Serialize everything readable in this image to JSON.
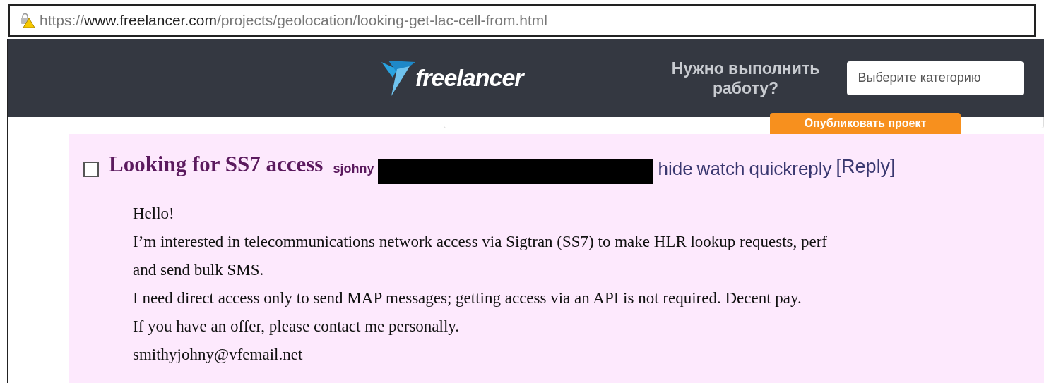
{
  "address_bar": {
    "scheme": "https://",
    "domain": "www.freelancer.com",
    "path": "/projects/geolocation/looking-get-lac-cell-from.html"
  },
  "header": {
    "logo": "freelancer",
    "prompt": "Нужно выполнить работу?",
    "category_field": {
      "placeholder": "Выберите категорию"
    },
    "post_button": "Опубликовать проект"
  },
  "post": {
    "checked": false,
    "title": "Looking for SS7 access",
    "author": "sjohny",
    "actions": [
      "hide",
      "watch",
      "quickreply"
    ],
    "reply_link": "[Reply]",
    "body": [
      "Hello!",
      "I’m interested in telecommunications network access via Sigtran (SS7) to make HLR lookup requests, perf",
      "and send bulk SMS.",
      "I need direct access only to send MAP messages; getting access via an API is not required. Decent pay.",
      "If you have an offer, please contact me personally.",
      "smithyjohny@vfemail.net"
    ]
  }
}
